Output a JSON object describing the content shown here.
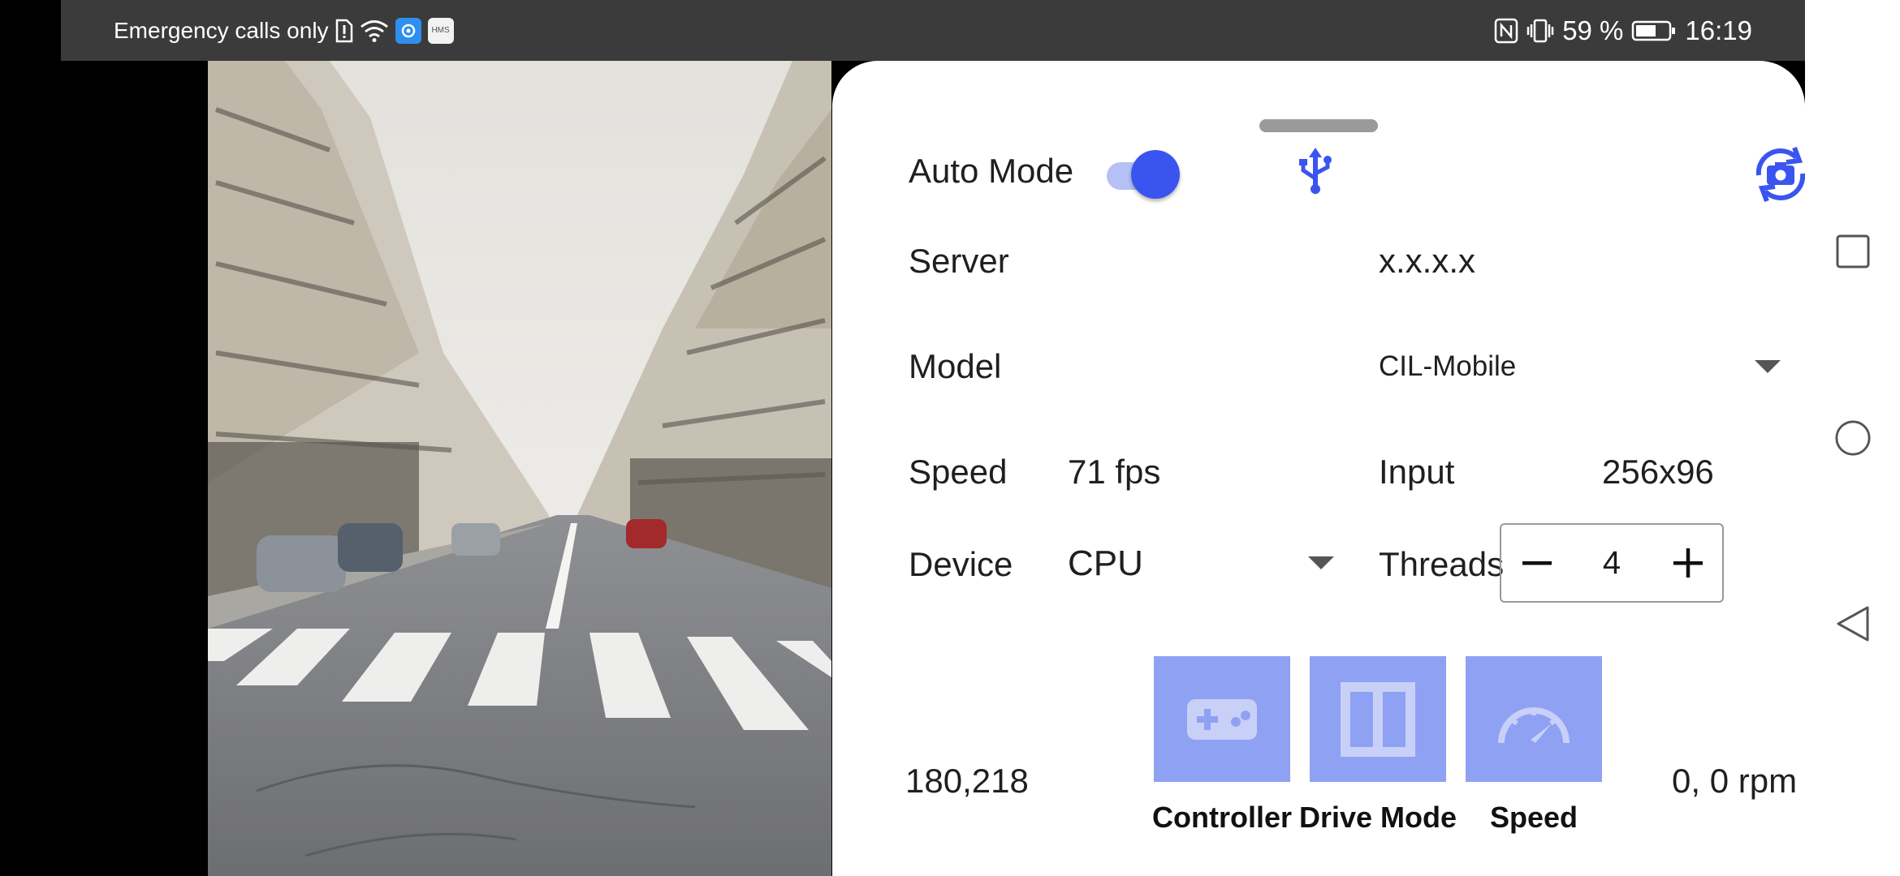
{
  "status_bar": {
    "carrier_text": "Emergency calls only",
    "battery_text": "59 %",
    "time": "16:19",
    "app_badge_text": "HMS",
    "icons": [
      "sim-alert-icon",
      "wifi-icon",
      "app-icon",
      "hms-icon",
      "nfc-icon",
      "vibrate-icon",
      "battery-icon"
    ]
  },
  "camera": {
    "description_icon": "camera-preview"
  },
  "panel": {
    "auto_mode_label": "Auto Mode",
    "auto_mode_on": true,
    "server_label": "Server",
    "server_value": "x.x.x.x",
    "model_label": "Model",
    "model_value": "CIL-Mobile",
    "speed_label": "Speed",
    "speed_value": "71 fps",
    "input_label": "Input",
    "input_value": "256x96",
    "device_label": "Device",
    "device_value": "CPU",
    "threads_label": "Threads",
    "threads_value": "4",
    "coords_text": "180,218",
    "rpm_text": "0,  0 rpm",
    "buttons": {
      "controller": "Controller",
      "drive_mode": "Drive Mode",
      "speed": "Speed"
    }
  },
  "colors": {
    "accent": "#3a55ef",
    "button_bg": "#8fa1f2",
    "status_bar_bg": "#3b3b3b"
  }
}
